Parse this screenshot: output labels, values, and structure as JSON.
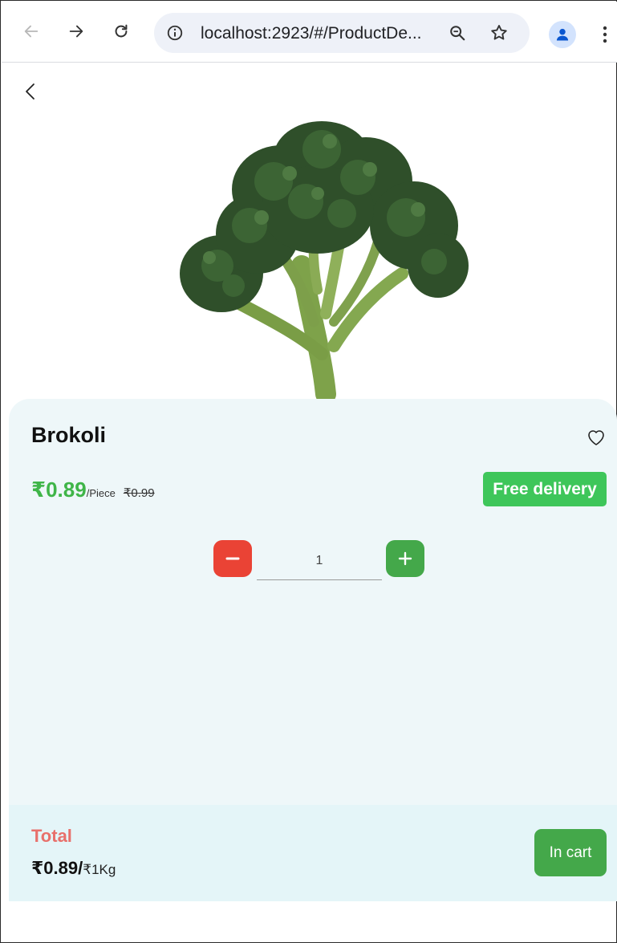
{
  "browser": {
    "url": "localhost:2923/#/ProductDe...",
    "icons": {
      "back": "arrow-left-icon",
      "forward": "arrow-right-icon",
      "reload": "reload-icon",
      "info": "info-icon",
      "zoom": "zoom-out-icon",
      "bookmark": "star-icon",
      "profile": "profile-icon",
      "menu": "more-vert-icon"
    }
  },
  "page": {
    "back_icon": "chevron-left-icon",
    "product": {
      "name": "Brokoli",
      "image": "broccoli-image",
      "price": "₹0.89",
      "unit": "/Piece",
      "old_price": "₹0.99",
      "delivery_badge": "Free delivery",
      "favorite_icon": "heart-outline-icon"
    },
    "quantity": {
      "value": "1",
      "minus_icon": "minus-icon",
      "plus_icon": "plus-icon"
    },
    "footer": {
      "total_label": "Total",
      "total_price": "₹0.89/",
      "total_unit": "₹1Kg",
      "cart_button": "In cart"
    }
  },
  "colors": {
    "accent_green": "#3fb548",
    "badge_green": "#3ec65a",
    "button_green": "#44a84a",
    "minus_red": "#ea4335",
    "total_label": "#e8706b",
    "panel_bg": "#eef7f9",
    "footer_bg": "#e4f5f8"
  }
}
